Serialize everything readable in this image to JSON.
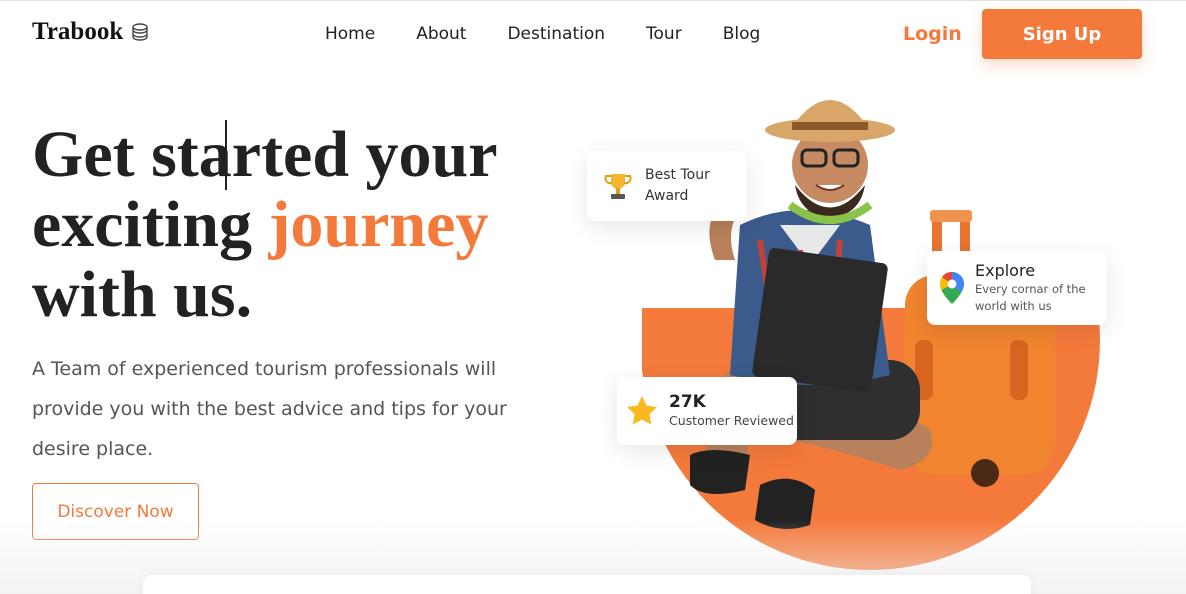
{
  "brand": {
    "name": "Trabook",
    "icon": "stacked-coins-icon"
  },
  "nav": {
    "items": [
      {
        "label": "Home"
      },
      {
        "label": "About"
      },
      {
        "label": "Destination"
      },
      {
        "label": "Tour"
      },
      {
        "label": "Blog"
      }
    ],
    "login_label": "Login",
    "signup_label": "Sign Up"
  },
  "hero": {
    "headline_pre": "Get started your exciting ",
    "headline_accent": "journey",
    "headline_post": " with us.",
    "subtitle": "A Team of experienced tourism professionals will provide you with the best advice and tips for your desire place.",
    "cta_label": "Discover Now"
  },
  "cards": {
    "award": {
      "label": "Best Tour Award",
      "icon": "trophy-icon"
    },
    "explore": {
      "title": "Explore",
      "subtitle": "Every cornar of the world with us",
      "icon": "map-pin-icon"
    },
    "reviews": {
      "count": "27K",
      "label": "Customer Reviewed",
      "icon": "star-icon"
    }
  },
  "colors": {
    "accent": "#f47a3c",
    "text": "#222222",
    "muted": "#555555"
  }
}
